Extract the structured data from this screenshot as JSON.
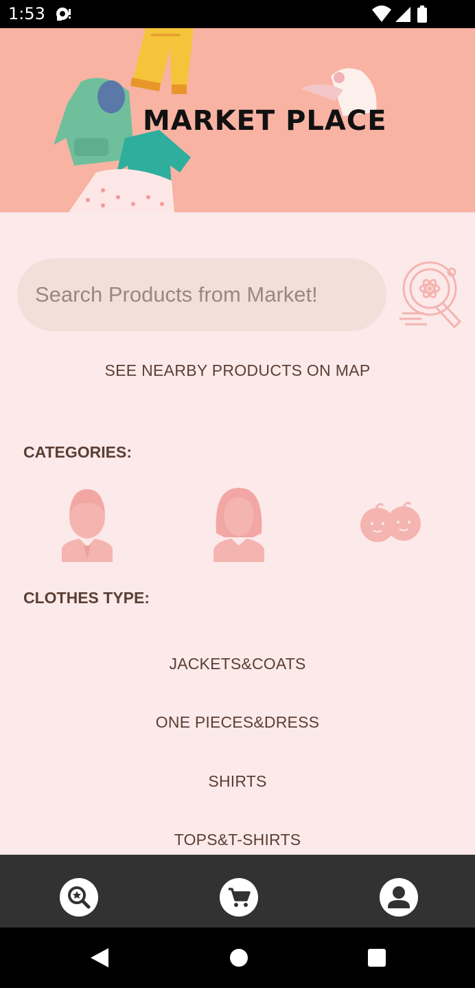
{
  "status": {
    "time": "1:53"
  },
  "banner": {
    "title": "MARKET PLACE"
  },
  "search": {
    "placeholder": "Search Products from Market!"
  },
  "map_link": "SEE NEARBY PRODUCTS ON MAP",
  "categories": {
    "title": "CATEGORIES:",
    "items": [
      {
        "icon": "man-icon"
      },
      {
        "icon": "woman-icon"
      },
      {
        "icon": "babies-icon"
      }
    ]
  },
  "clothes_type": {
    "title": "CLOTHES TYPE:",
    "items": [
      "JACKETS&COATS",
      "ONE PIECES&DRESS",
      "SHIRTS",
      "TOPS&T-SHIRTS"
    ]
  },
  "bottom_nav": [
    {
      "icon": "search-star-icon"
    },
    {
      "icon": "cart-icon"
    },
    {
      "icon": "account-icon"
    }
  ],
  "colors": {
    "banner": "#f8b3a3",
    "background": "#fce9ea",
    "search_field": "#f2dfd9",
    "text": "#5b3e33",
    "icon_pink": "#f4b4b0",
    "bottom_nav": "#323232"
  }
}
